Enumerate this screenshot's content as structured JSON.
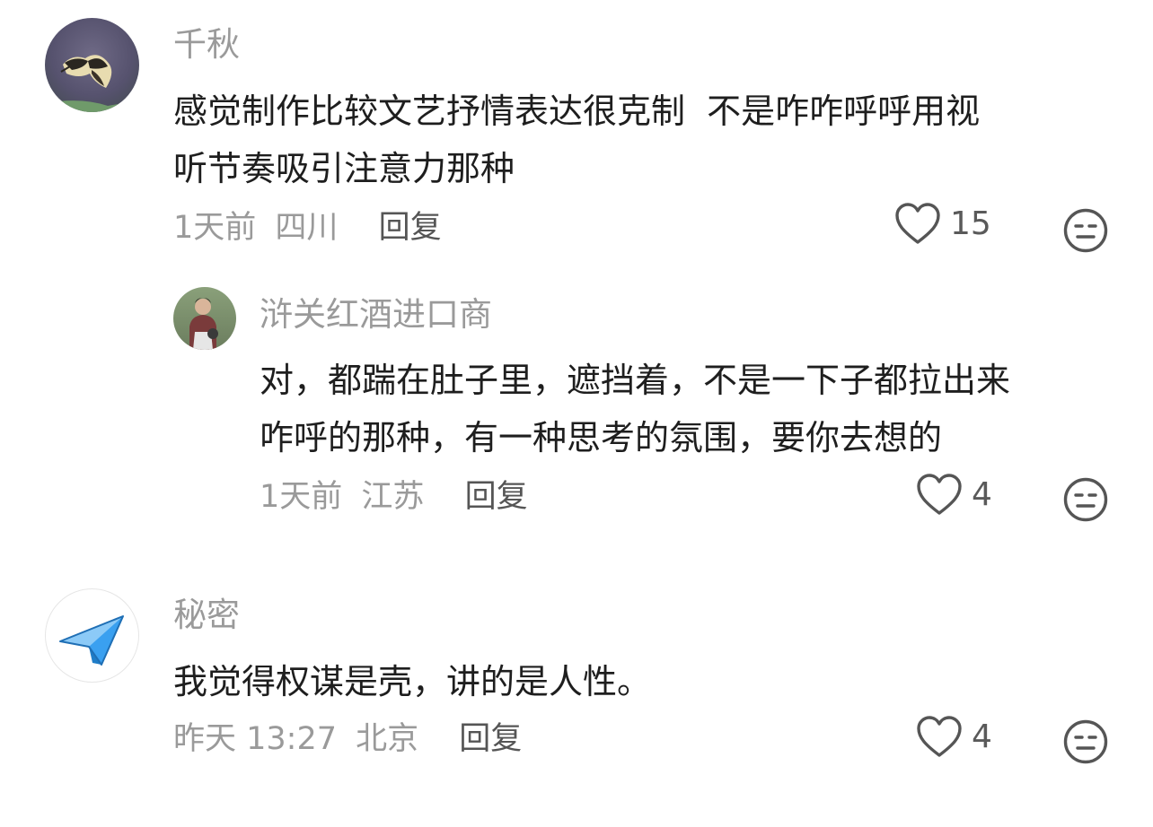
{
  "comments": [
    {
      "username": "千秋",
      "text_line1": "感觉制作比较文艺抒情表达很克制  不是咋咋呼呼用视",
      "text_line2": "听节奏吸引注意力那种",
      "time": "1天前",
      "location": "四川",
      "reply_label": "回复",
      "likes": "15",
      "reply": {
        "username": "浒关红酒进口商",
        "text_line1": "对，都踹在肚子里，遮挡着，不是一下子都拉出来",
        "text_line2": "咋呼的那种，有一种思考的氛围，要你去想的",
        "time": "1天前",
        "location": "江苏",
        "reply_label": "回复",
        "likes": "4"
      }
    },
    {
      "username": "秘密",
      "text_line1": "我觉得权谋是壳，讲的是人性。",
      "time": "昨天 13:27",
      "location": "北京",
      "reply_label": "回复",
      "likes": "4"
    }
  ],
  "icons": {
    "like": "heart-outline-icon",
    "dislike": "neutral-face-icon",
    "avatar3": "paper-plane-icon"
  },
  "colors": {
    "secondary_text": "#9a9a9a",
    "icon_gray": "#555555",
    "plane_blue": "#3aa0f0"
  }
}
